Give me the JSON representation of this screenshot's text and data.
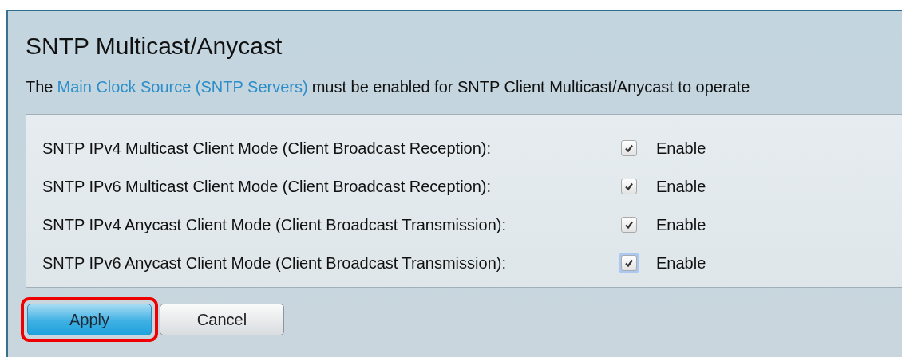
{
  "panel": {
    "title": "SNTP Multicast/Anycast",
    "notice": {
      "before": "The",
      "link": "Main Clock Source (SNTP Servers)",
      "after": "must be enabled for SNTP Client Multicast/Anycast to operate"
    },
    "settings": [
      {
        "label": "SNTP IPv4 Multicast Client Mode (Client Broadcast Reception):",
        "checked": true,
        "focused": false,
        "option": "Enable"
      },
      {
        "label": "SNTP IPv6 Multicast Client Mode (Client Broadcast Reception):",
        "checked": true,
        "focused": false,
        "option": "Enable"
      },
      {
        "label": "SNTP IPv4 Anycast Client Mode (Client Broadcast Transmission):",
        "checked": true,
        "focused": false,
        "option": "Enable"
      },
      {
        "label": "SNTP IPv6 Anycast Client Mode (Client Broadcast Transmission):",
        "checked": true,
        "focused": true,
        "option": "Enable"
      }
    ],
    "buttons": [
      {
        "label": "Apply",
        "kind": "primary",
        "highlighted": true
      },
      {
        "label": "Cancel",
        "kind": "secondary",
        "highlighted": false
      }
    ]
  }
}
